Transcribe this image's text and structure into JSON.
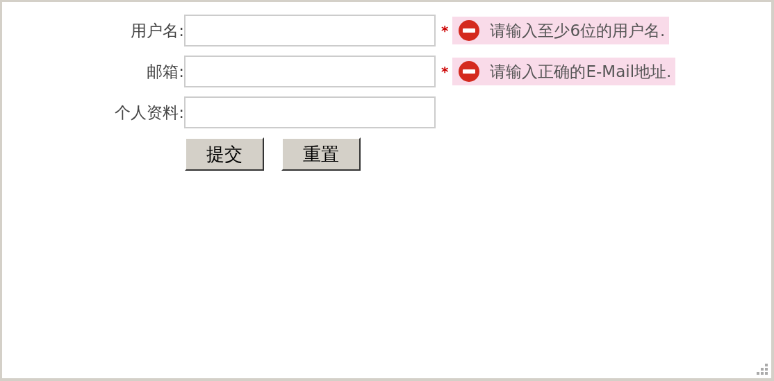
{
  "fields": [
    {
      "label": "用户名:",
      "marker": "*",
      "error": "请输入至少6位的用户名."
    },
    {
      "label": "邮箱:",
      "marker": "*",
      "error": "请输入正确的E-Mail地址."
    },
    {
      "label": "个人资料:"
    }
  ],
  "buttons": [
    "提交",
    "重置"
  ]
}
